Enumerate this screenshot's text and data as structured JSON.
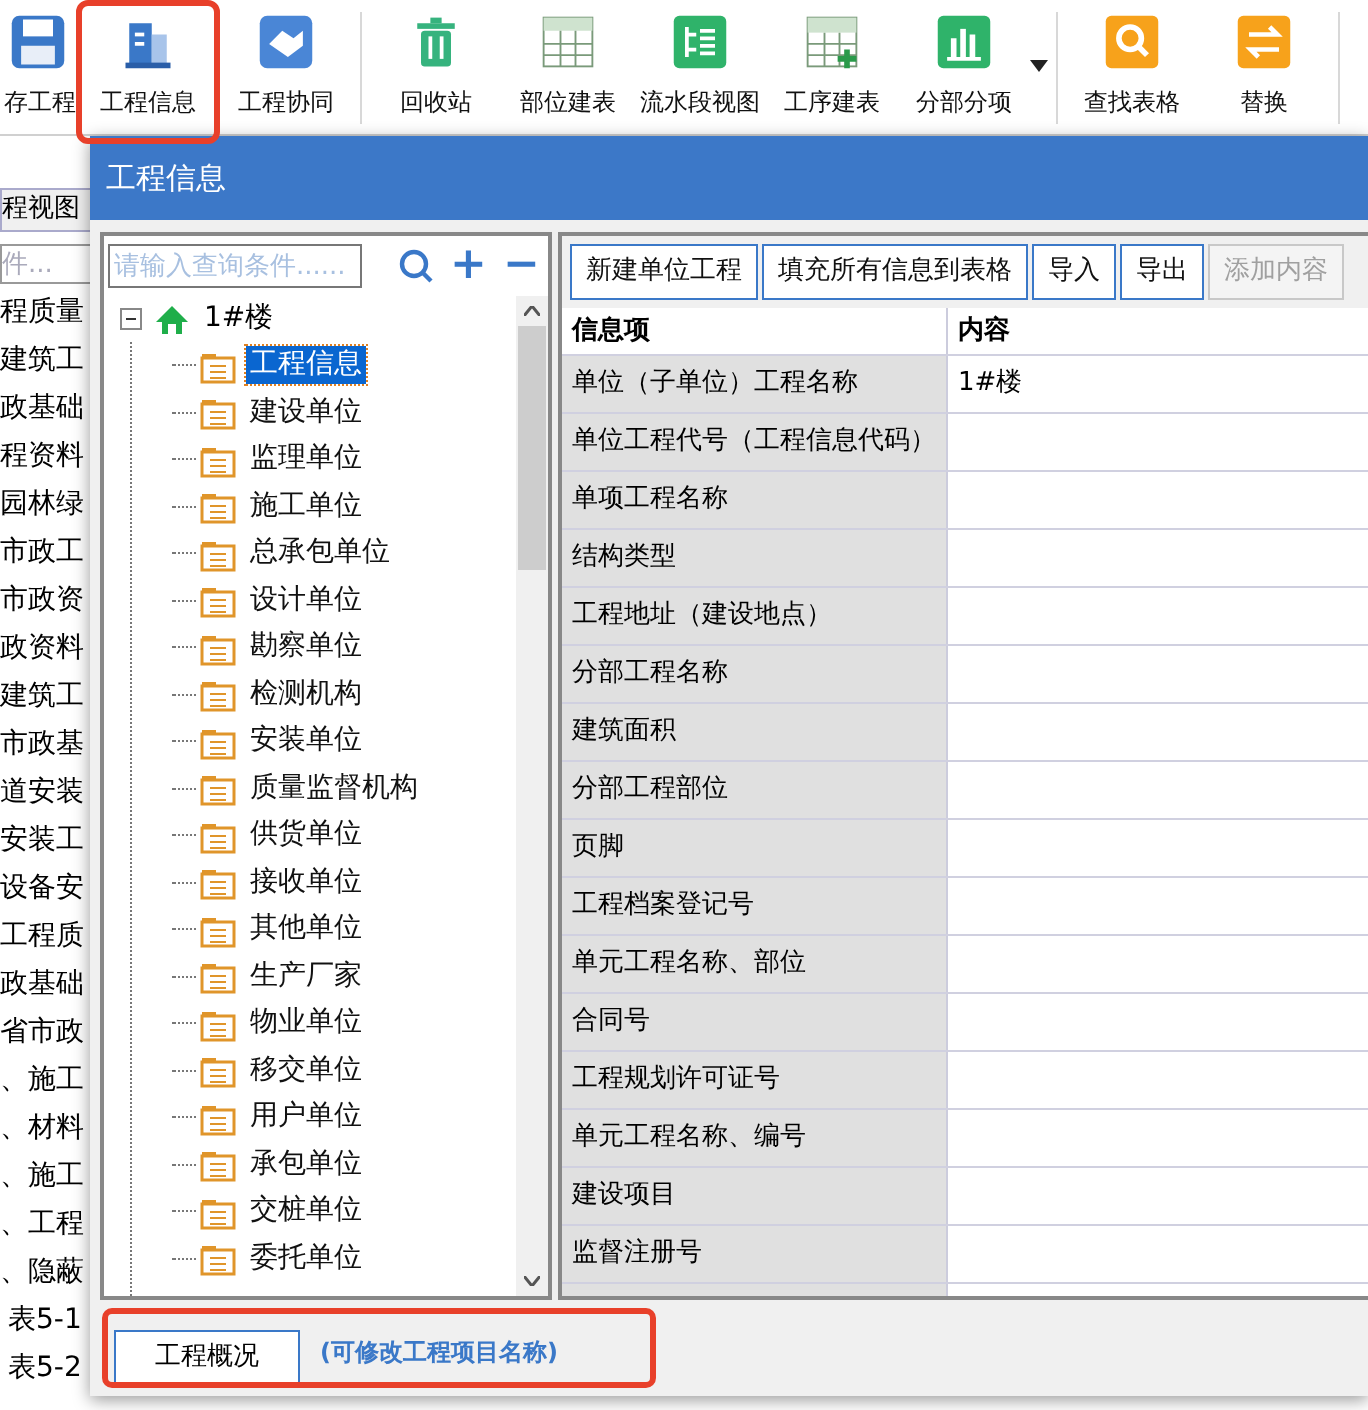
{
  "toolbar": [
    {
      "kind": "button",
      "label": "存工程",
      "highlighted": false
    },
    {
      "kind": "button",
      "label": "工程信息",
      "highlighted": true
    },
    {
      "kind": "button",
      "label": "工程协同",
      "highlighted": false
    },
    {
      "kind": "sep"
    },
    {
      "kind": "button",
      "label": "回收站",
      "highlighted": false
    },
    {
      "kind": "button",
      "label": "部位建表",
      "highlighted": false
    },
    {
      "kind": "button",
      "label": "流水段视图",
      "highlighted": false
    },
    {
      "kind": "button",
      "label": "工序建表",
      "highlighted": false
    },
    {
      "kind": "button",
      "label": "分部分项",
      "highlighted": false
    },
    {
      "kind": "dropdown"
    },
    {
      "kind": "sep"
    },
    {
      "kind": "button",
      "label": "查找表格",
      "highlighted": false
    },
    {
      "kind": "button",
      "label": "替换",
      "highlighted": false
    },
    {
      "kind": "sep"
    }
  ],
  "background": {
    "tab": "程视图",
    "search_placeholder": "件...",
    "items": [
      "程质量",
      "建筑工",
      "政基础",
      "程资料",
      "园林绿",
      "市政工",
      "市政资",
      "政资料",
      "建筑工",
      "市政基",
      "道安装",
      "安装工",
      "设备安",
      "工程质",
      "政基础",
      "省市政",
      "、施工",
      "、材料",
      "、施工",
      "、工程",
      "、隐蔽",
      "表5-1",
      "表5-2"
    ]
  },
  "dialog": {
    "title": "工程信息",
    "tree_search": {
      "placeholder": "请输入查询条件......",
      "add": "+",
      "remove": "−"
    },
    "tree": [
      {
        "label": "1#楼",
        "expanded": true,
        "selected": false,
        "children": [
          {
            "label": "工程信息",
            "selected": true
          },
          {
            "label": "建设单位",
            "selected": false
          },
          {
            "label": "监理单位",
            "selected": false
          },
          {
            "label": "施工单位",
            "selected": false
          },
          {
            "label": "总承包单位",
            "selected": false
          },
          {
            "label": "设计单位",
            "selected": false
          },
          {
            "label": "勘察单位",
            "selected": false
          },
          {
            "label": "检测机构",
            "selected": false
          },
          {
            "label": "安装单位",
            "selected": false
          },
          {
            "label": "质量监督机构",
            "selected": false
          },
          {
            "label": "供货单位",
            "selected": false
          },
          {
            "label": "接收单位",
            "selected": false
          },
          {
            "label": "其他单位",
            "selected": false
          },
          {
            "label": "生产厂家",
            "selected": false
          },
          {
            "label": "物业单位",
            "selected": false
          },
          {
            "label": "移交单位",
            "selected": false
          },
          {
            "label": "用户单位",
            "selected": false
          },
          {
            "label": "承包单位",
            "selected": false
          },
          {
            "label": "交桩单位",
            "selected": false
          },
          {
            "label": "委托单位",
            "selected": false
          }
        ]
      }
    ],
    "buttons": [
      {
        "label": "新建单位工程",
        "disabled": false
      },
      {
        "label": "填充所有信息到表格",
        "disabled": false
      },
      {
        "label": "导入",
        "disabled": false
      },
      {
        "label": "导出",
        "disabled": false
      },
      {
        "label": "添加内容",
        "disabled": true
      }
    ],
    "table": {
      "columns": [
        "信息项",
        "内容"
      ],
      "rows": [
        [
          "单位（子单位）工程名称",
          "1#楼"
        ],
        [
          "单位工程代号（工程信息代码）",
          ""
        ],
        [
          "单项工程名称",
          ""
        ],
        [
          "结构类型",
          ""
        ],
        [
          "工程地址（建设地点）",
          ""
        ],
        [
          "分部工程名称",
          ""
        ],
        [
          "建筑面积",
          ""
        ],
        [
          "分部工程部位",
          ""
        ],
        [
          "页脚",
          ""
        ],
        [
          "工程档案登记号",
          ""
        ],
        [
          "单元工程名称、部位",
          ""
        ],
        [
          "合同号",
          ""
        ],
        [
          "工程规划许可证号",
          ""
        ],
        [
          "单元工程名称、编号",
          ""
        ],
        [
          "建设项目",
          ""
        ],
        [
          "监督注册号",
          ""
        ],
        [
          "",
          ""
        ]
      ]
    },
    "bottom": {
      "tab": "工程概况",
      "hint": "(可修改工程项目名称)",
      "highlighted": true
    }
  }
}
